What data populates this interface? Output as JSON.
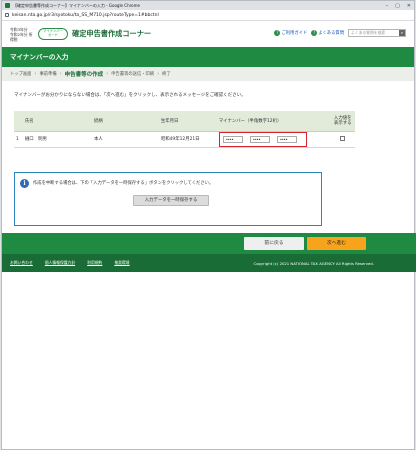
{
  "browser": {
    "title": "【確定申告書等作成コーナー】マイナンバーの入力 - Google Chrome",
    "url": "keisan.nta.go.jp/r3/syotoku/ta_SS_M710.jsp?routeType=1#bbctnl",
    "controls": [
      "–",
      "▢",
      "✕"
    ]
  },
  "header": {
    "era_line1": "令和3年分",
    "era_line2": "令和2年分 所得税",
    "logo_line1": "マイナンバー",
    "logo_line2": "カード",
    "site_title": "確定申告書作成コーナー",
    "guide_link": "ご利用ガイド",
    "faq_link": "よくある質問",
    "search_placeholder": "よくある質問を検索"
  },
  "page_title": "マイナンバーの入力",
  "breadcrumb": {
    "items": [
      "トップ画面",
      "事前準備",
      "申告書等の作成",
      "申告書等の送信・印刷",
      "終了"
    ],
    "active_index": 2
  },
  "instruction": "マイナンバーがお分かりにならない場合は、「次へ進む」をクリックし、表示されるメッセージをご確認ください。",
  "table": {
    "headers": [
      "氏名",
      "続柄",
      "生年月日",
      "マイナンバー（半角数字12桁）",
      "入力値を表示する"
    ],
    "rows": [
      {
        "no": "1",
        "name": "樋口　明男",
        "relation": "本人",
        "birthdate": "昭和49年12月21日",
        "mynumber": [
          "••••",
          "••••",
          "••••"
        ],
        "show": false
      }
    ]
  },
  "notice": {
    "text": "作成を中断する場合は、下の「入力データを一時保存する」ボタンをクリックしてください。",
    "save_button": "入力データを一時保存する"
  },
  "actions": {
    "back": "前に戻る",
    "next": "次へ進む"
  },
  "footer": {
    "links": [
      "お問い合わせ",
      "個人情報保護方針",
      "利用規約",
      "推奨環境"
    ],
    "copyright": "Copyright (c) 2021 NATIONAL TAX AGENCY All Rights Reserved."
  },
  "colors": {
    "brand_green": "#1f8a42",
    "next_orange": "#f7a31c",
    "highlight_red": "#d6252e",
    "info_blue": "#2e6db5"
  }
}
